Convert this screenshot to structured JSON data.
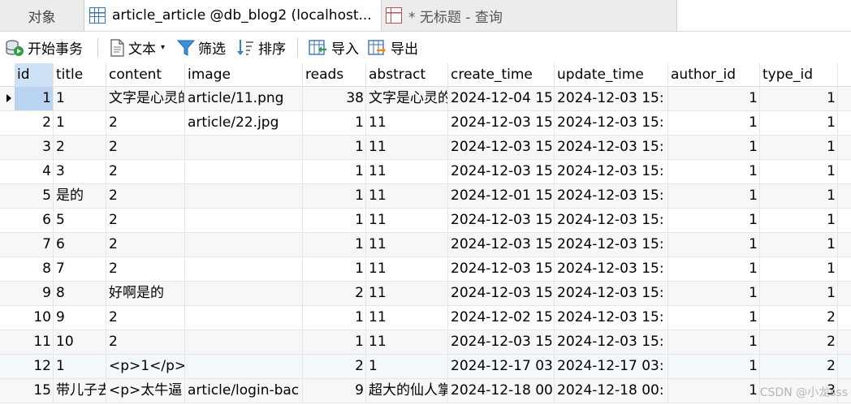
{
  "tabs": {
    "objects": "对象",
    "active": "article_article @db_blog2 (localhost...",
    "query": "* 无标题 - 查询"
  },
  "toolbar": {
    "begin_transaction": "开始事务",
    "text": "文本",
    "filter": "筛选",
    "sort": "排序",
    "import": "导入",
    "export": "导出"
  },
  "columns": [
    "id",
    "title",
    "content",
    "image",
    "reads",
    "abstract",
    "create_time",
    "update_time",
    "author_id",
    "type_id"
  ],
  "rows": [
    {
      "id": "1",
      "title": "1",
      "content": "文字是心灵的",
      "image": "article/11.png",
      "reads": "38",
      "abstract": "文字是心灵的",
      "create_time": "2024-12-04 15:",
      "update_time": "2024-12-03 15:",
      "author_id": "1",
      "type_id": "1"
    },
    {
      "id": "2",
      "title": "1",
      "content": "2",
      "image": "article/22.jpg",
      "reads": "1",
      "abstract": "11",
      "create_time": "2024-12-03 15:",
      "update_time": "2024-12-03 15:",
      "author_id": "1",
      "type_id": "1"
    },
    {
      "id": "3",
      "title": "2",
      "content": "2",
      "image": "",
      "reads": "1",
      "abstract": "11",
      "create_time": "2024-12-03 15:",
      "update_time": "2024-12-03 15:",
      "author_id": "1",
      "type_id": "1"
    },
    {
      "id": "4",
      "title": "3",
      "content": "2",
      "image": "",
      "reads": "1",
      "abstract": "11",
      "create_time": "2024-12-03 15:",
      "update_time": "2024-12-03 15:",
      "author_id": "1",
      "type_id": "1"
    },
    {
      "id": "5",
      "title": "是的",
      "content": "2",
      "image": "",
      "reads": "1",
      "abstract": "11",
      "create_time": "2024-12-01 15:",
      "update_time": "2024-12-03 15:",
      "author_id": "1",
      "type_id": "1"
    },
    {
      "id": "6",
      "title": "5",
      "content": "2",
      "image": "",
      "reads": "1",
      "abstract": "11",
      "create_time": "2024-12-03 15:",
      "update_time": "2024-12-03 15:",
      "author_id": "1",
      "type_id": "1"
    },
    {
      "id": "7",
      "title": "6",
      "content": "2",
      "image": "",
      "reads": "1",
      "abstract": "11",
      "create_time": "2024-12-03 15:",
      "update_time": "2024-12-03 15:",
      "author_id": "1",
      "type_id": "1"
    },
    {
      "id": "8",
      "title": "7",
      "content": "2",
      "image": "",
      "reads": "1",
      "abstract": "11",
      "create_time": "2024-12-03 15:",
      "update_time": "2024-12-03 15:",
      "author_id": "1",
      "type_id": "1"
    },
    {
      "id": "9",
      "title": "8",
      "content": "好啊是的",
      "image": "",
      "reads": "2",
      "abstract": "11",
      "create_time": "2024-12-03 15:",
      "update_time": "2024-12-03 15:",
      "author_id": "1",
      "type_id": "1"
    },
    {
      "id": "10",
      "title": "9",
      "content": "2",
      "image": "",
      "reads": "1",
      "abstract": "11",
      "create_time": "2024-12-02 15:",
      "update_time": "2024-12-03 15:",
      "author_id": "1",
      "type_id": "2"
    },
    {
      "id": "11",
      "title": "10",
      "content": "2",
      "image": "",
      "reads": "1",
      "abstract": "11",
      "create_time": "2024-12-03 15:",
      "update_time": "2024-12-03 15:",
      "author_id": "1",
      "type_id": "2"
    },
    {
      "id": "12",
      "title": "1",
      "content": "<p>1</p>",
      "image": "",
      "reads": "2",
      "abstract": "1",
      "create_time": "2024-12-17 03:",
      "update_time": "2024-12-17 03:",
      "author_id": "1",
      "type_id": "2"
    },
    {
      "id": "15",
      "title": "带儿子去",
      "content": "<p>太牛逼",
      "image": "article/login-bac",
      "reads": "9",
      "abstract": "超大的仙人掌",
      "create_time": "2024-12-18 00:",
      "update_time": "2024-12-18 00:",
      "author_id": "1",
      "type_id": "3"
    }
  ],
  "watermark": "CSDN @小龙sss"
}
